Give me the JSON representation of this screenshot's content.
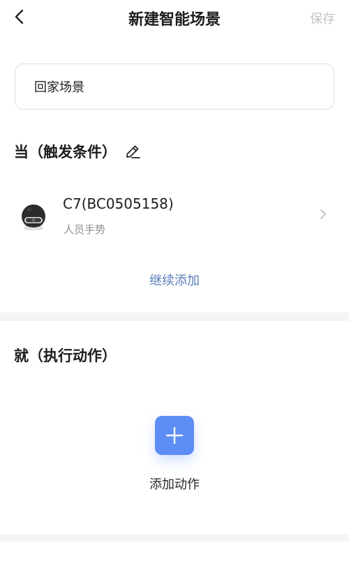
{
  "header": {
    "title": "新建智能场景",
    "save_label": "保存"
  },
  "scene": {
    "name_value": "回家场景"
  },
  "condition": {
    "section_title": "当（触发条件）",
    "device": {
      "name": "C7(BC0505158)",
      "trigger": "人员手势",
      "icon": "camera-icon"
    },
    "continue_add_label": "继续添加"
  },
  "action": {
    "section_title": "就（执行动作）",
    "add_label": "添加动作"
  },
  "colors": {
    "accent": "#5d8ef5",
    "link": "#5b7fb8",
    "muted": "#8f8f8f",
    "disabled": "#c4c4c4"
  }
}
